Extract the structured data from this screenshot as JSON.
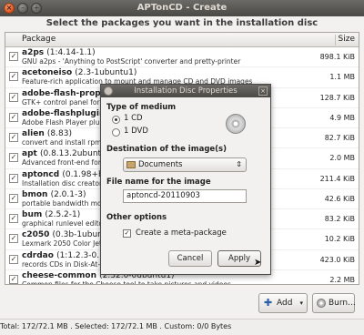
{
  "window": {
    "title": "APTonCD - Create"
  },
  "instruction": "Select the packages you want in the installation disc",
  "table": {
    "columns": [
      "Package",
      "Size"
    ],
    "rows": [
      {
        "name": "a2ps",
        "version": "(1:4.14-1.1)",
        "description": "GNU a2ps - 'Anything to PostScript' converter and pretty-printer",
        "size": "898.1 KiB",
        "checked": true
      },
      {
        "name": "acetoneiso",
        "version": "(2.3-1ubuntu1)",
        "description": "Feature-rich application to mount and manage CD and DVD images",
        "size": "1.1 MB",
        "checked": true
      },
      {
        "name": "adobe-flash-propert",
        "version": "",
        "description": "GTK+ control panel for Ad",
        "size": "128.7 KiB",
        "checked": true
      },
      {
        "name": "adobe-flashplugin",
        "version": "(1",
        "description": "Adobe Flash Player plugin",
        "size": "4.9 MB",
        "checked": true
      },
      {
        "name": "alien",
        "version": "(8.83)",
        "description": "convert and install rpm an",
        "size": "82.7 KiB",
        "checked": true
      },
      {
        "name": "apt",
        "version": "(0.8.13.2ubuntu4.1)",
        "description": "Advanced front-end for d",
        "size": "2.0 MB",
        "checked": true
      },
      {
        "name": "aptoncd",
        "version": "(0.1.98+bzr117",
        "description": "Installation disc creator fo",
        "size": "211.4 KiB",
        "checked": true
      },
      {
        "name": "bmon",
        "version": "(2.0.1-3)",
        "description": "portable bandwidth monit",
        "size": "42.6 KiB",
        "checked": true
      },
      {
        "name": "bum",
        "version": "(2.5.2-1)",
        "description": "graphical runlevel editor",
        "size": "83.2 KiB",
        "checked": true
      },
      {
        "name": "c2050",
        "version": "(0.3b-1ubuntu1)",
        "description": "Lexmark 2050 Color Jetpr",
        "size": "10.2 KiB",
        "checked": true
      },
      {
        "name": "cdrdao",
        "version": "(1:1.2.3-0.1ubuntu",
        "description": "records CDs in Disk-At-On",
        "size": "423.0 KiB",
        "checked": true
      },
      {
        "name": "cheese-common",
        "version": "(2.32.0-0ubuntu1)",
        "description": "Common files for the Cheese tool to take pictures and videos",
        "size": "2.2 MB",
        "checked": true
      }
    ]
  },
  "buttons": {
    "add": "Add",
    "burn": "Burn..."
  },
  "status": "Total: 172/72.1 MB . Selected: 172/72.1 MB . Custom: 0/0 Bytes",
  "dialog": {
    "title": "Installation Disc Properties",
    "type_label": "Type of medium",
    "media": [
      {
        "label": "1 CD",
        "selected": true
      },
      {
        "label": "1 DVD",
        "selected": false
      }
    ],
    "destination_label": "Destination of the image(s)",
    "destination_value": "Documents",
    "filename_label": "File name for the image",
    "filename_value": "aptoncd-20110903",
    "other_label": "Other options",
    "meta_label": "Create a meta-package",
    "meta_checked": true,
    "cancel": "Cancel",
    "apply": "Apply"
  }
}
